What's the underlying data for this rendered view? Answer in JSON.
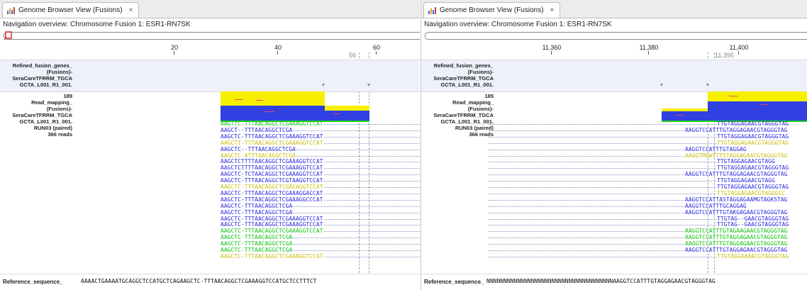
{
  "panels": [
    {
      "tab_title": "Genome Browser View (Fusions)",
      "tab_close": "×",
      "nav_label": "Navigation overview: Chromosome Fusion 1: ESR1-RN7SK",
      "ruler_ticks": [
        "20",
        "40",
        "60"
      ],
      "ruler_marker": "56",
      "fusion_track_label": "Refined_fusion_genes_\n(Fusions)-\nSeraCareTFRRM_TGCA\nGCTA_L001_R1_001.",
      "read_track_label": "Read_mapping_\n(Fusions)-\nSeraCareTFRRM_TGCA\nGCTA_L001_R1_001.\nRUN03 (paired)\n366 reads",
      "coverage_max": "189",
      "reference_label": "Reference_sequence_",
      "reference_seq": "AAAACTGAAAATGCAGGCTCCATGCTCAGAAGCTC-TTTAACAGGCTCGAAAGGTCCATGCTCCTTTCT"
    },
    {
      "tab_title": "Genome Browser View (Fusions)",
      "tab_close": "×",
      "nav_label": "Navigation overview: Chromosome Fusion 1: ESR1-RN7SK",
      "ruler_ticks": [
        "11,360",
        "11,380",
        "11,400"
      ],
      "ruler_marker": "11,395",
      "fusion_track_label": "Refined_fusion_genes_\n(Fusions)-\nSeraCareTFRRM_TGCA\nGCTA_L001_R1_001.",
      "read_track_label": "Read_mapping_\n(Fusions)-\nSeraCareTFRRM_TGCA\nGCTA_L001_R1_001.\nRUN03 (paired)\n366 reads",
      "coverage_max": "185",
      "reference_label": "Reference_sequence_",
      "reference_seq": "NNNNNNNNNNNNNNNNNNNNNNNNNNNNNNNNNNNNNAAGGTCCATTTGTAGGAGAACGTAGGGTAG"
    }
  ],
  "reads_left": [
    {
      "seq": "AAGTTC-TTTAACAGGCTCGAAAGGTCCAT",
      "color": "green"
    },
    {
      "seq": "AAGCT--TTTAACAGGCTCGA",
      "color": "blue"
    },
    {
      "seq": "AAGCTC-TTTAACAGGCTCGAAAGGTCCAT",
      "color": "blue"
    },
    {
      "seq": "AAGCTT-TTTAACAGGCTCGAAAGGTCCAT",
      "color": "yellow"
    },
    {
      "seq": "AAGCTC--TTTAACAGGCTCGA",
      "color": "blue"
    },
    {
      "seq": "AAGCTC-ATTTAACAGGCTCGA",
      "color": "yellow"
    },
    {
      "seq": "AAGCTCTTTTAACAGGCTCGAAAGGTCCAT",
      "color": "blue"
    },
    {
      "seq": "AAGCTCTTTTAACAGGCTCGAAAGGTCCAT",
      "color": "blue"
    },
    {
      "seq": "AAGCTC-TCTAACAGGCTCGAAAGGTCCAT",
      "color": "blue"
    },
    {
      "seq": "AAGCTC-TTTAACAGGCTCGTAAGGTCCAT",
      "color": "blue"
    },
    {
      "seq": "AAGCTC-TTTAACAGGCTCGACAGGTCCAT",
      "color": "yellow"
    },
    {
      "seq": "AAGCTC-TTTAACAGGCTCGAAAGGACCAT",
      "color": "blue"
    },
    {
      "seq": "AAGCTC-TTTAACAGGCTCGAAAGGCCCAT",
      "color": "blue"
    },
    {
      "seq": "AAGCTC-TTTAACAGGCTCGA",
      "color": "blue"
    },
    {
      "seq": "AAGCTC-TTTAACAGGCTCGA",
      "color": "blue"
    },
    {
      "seq": "AAGCTC-TTTAACAGGCTCGAAAGGTCCAT",
      "color": "blue"
    },
    {
      "seq": "AAGCTC-TTTAACAGGCTCGAAAGGTCCAT",
      "color": "blue"
    },
    {
      "seq": "AAGCTC-TTTAACAGGCTCGAAAGGTCCAT",
      "color": "green"
    },
    {
      "seq": "AAGCTC-TTTAACAGGCTCGA",
      "color": "green"
    },
    {
      "seq": "AAGCTC-TTTAACAGGCTCGA",
      "color": "green"
    },
    {
      "seq": "AAGCTC-TTTAACAGGCTCGA",
      "color": "green"
    },
    {
      "seq": "AAGCTC-TTTAACAGGCTCGAAAGGTCCAT",
      "color": "yellow"
    }
  ],
  "reads_right": [
    {
      "seq": "TTGTAGGAGAACGTAGGGTAG",
      "color": "blue",
      "offset": 0
    },
    {
      "seq": "AAGGTCCATTTGTAGGAGAACGTAGGGTAG",
      "color": "blue",
      "offset": 1
    },
    {
      "seq": "TTGTAGGAGAACGTAGGGTAG",
      "color": "blue",
      "offset": 0
    },
    {
      "seq": "TTGTAGGAGAACGTAGGGTAG",
      "color": "yellow",
      "offset": 0
    },
    {
      "seq": "AAGGTCCATTTGTAGGAG",
      "color": "blue",
      "offset": 1
    },
    {
      "seq": "AAGGTMCWTTTSTAGGAGAACGTAGGGTAG",
      "color": "yellow",
      "offset": 1
    },
    {
      "seq": "TTGTAGGAGAACGTAGG",
      "color": "blue",
      "offset": 0
    },
    {
      "seq": "TTGTAGGAGAACGTAGGGTAG",
      "color": "blue",
      "offset": 0
    },
    {
      "seq": "AAGGTCCATTTGTAGGAGAACGTAGGGTAG",
      "color": "blue",
      "offset": 1
    },
    {
      "seq": "TTGTAGGAGAACGTAGG",
      "color": "blue",
      "offset": 0
    },
    {
      "seq": "TTGTAGGAGAACGTAGGGTAG",
      "color": "blue",
      "offset": 0
    },
    {
      "seq": "TTGTAGGAGAACGTAGGGCC",
      "color": "yellow",
      "offset": 0
    },
    {
      "seq": "AAGGTCCATTASTAGGAGAAMGTAGKSTAG",
      "color": "blue",
      "offset": 1
    },
    {
      "seq": "AAGGTCCATTTGCAGGAG",
      "color": "blue",
      "offset": 1
    },
    {
      "seq": "AAGGTCCATTTGTAKGAGAACGTAGGGTAG",
      "color": "blue",
      "offset": 1
    },
    {
      "seq": "TTGTAG--GAACGTAGGGTAG",
      "color": "blue",
      "offset": 0
    },
    {
      "seq": "TTGTAG--GAACGTAGGGTAG",
      "color": "blue",
      "offset": 0
    },
    {
      "seq": "AAGGTCCATTTGTAGAAGAACGTAGGGTAG",
      "color": "green",
      "offset": 1
    },
    {
      "seq": "AAGGTCCATTTGTAGGAGAACGTAGGGTAG",
      "color": "green",
      "offset": 1
    },
    {
      "seq": "AAGGTCCATTTGTAGGAGAACGTAGGGTAG",
      "color": "green",
      "offset": 1
    },
    {
      "seq": "AAGGTCCATTTGTAGGAGAACGTAGGGTAG",
      "color": "blue",
      "offset": 1
    },
    {
      "seq": "TTGTAGGAAAACGTAGGGTAG",
      "color": "yellow",
      "offset": 0
    }
  ],
  "colors": {
    "coverage_yellow": "#f6f000",
    "coverage_blue": "#3140e0",
    "read_green": "#13c313",
    "read_blue": "#2a2ae0",
    "read_yellow": "#c9bf13",
    "fusion_band": "#eef0fa"
  }
}
